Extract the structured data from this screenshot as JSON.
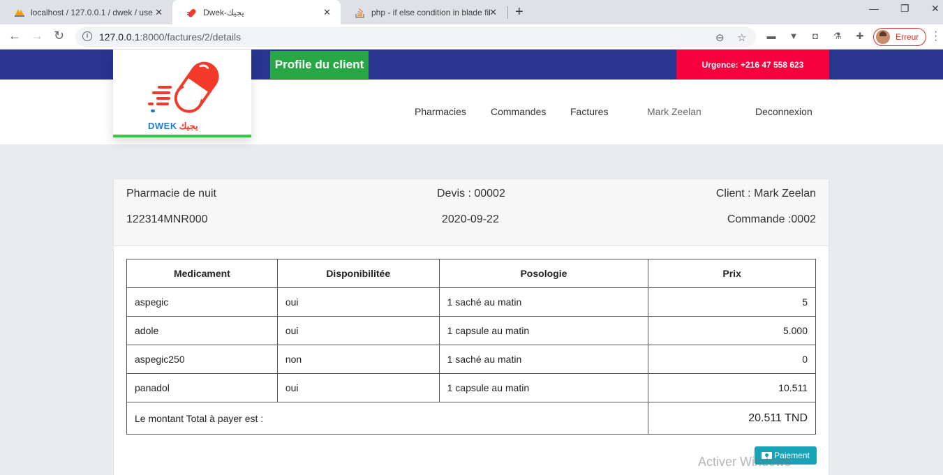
{
  "browser": {
    "tabs": [
      {
        "title": "localhost / 127.0.0.1 / dwek / use",
        "icon": "phpmyadmin-icon"
      },
      {
        "title": "Dwek-يجيك",
        "icon": "dwek-pill-icon"
      },
      {
        "title": "php - if else condition in blade fil",
        "icon": "stackoverflow-icon"
      }
    ],
    "url_host": "127.0.0.1",
    "url_path": ":8000/factures/2/details",
    "profile_label": "Erreur"
  },
  "header": {
    "profile_tag": "Profile du client",
    "urgence": "Urgence: +216 47 558 623",
    "logo_text": "DWEK",
    "logo_arabic": "يجيك",
    "nav": [
      "Pharmacies",
      "Commandes",
      "Factures",
      "Mark Zeelan",
      "Deconnexion"
    ]
  },
  "invoice": {
    "pharmacy": "Pharmacie de nuit",
    "pharmacy_code": "122314MNR000",
    "devis": "Devis : 00002",
    "date": "2020-09-22",
    "client": "Client : Mark Zeelan",
    "commande": "Commande :0002",
    "columns": [
      "Medicament",
      "Disponibilitée",
      "Posologie",
      "Prix"
    ],
    "rows": [
      {
        "med": "aspegic",
        "dispo": "oui",
        "poso": "1 saché au matin",
        "prix": "5"
      },
      {
        "med": "adole",
        "dispo": "oui",
        "poso": "1 capsule au matin",
        "prix": "5.000"
      },
      {
        "med": "aspegic250",
        "dispo": "non",
        "poso": "1 saché au matin",
        "prix": "0"
      },
      {
        "med": "panadol",
        "dispo": "oui",
        "poso": "1 capsule au matin",
        "prix": "10.511"
      }
    ],
    "total_label": "Le montant Total à payer est :",
    "total_value": "20.511 TND",
    "pay_button": "Paiement"
  },
  "watermark": "Activer Windows",
  "colors": {
    "topstrip": "#28358f",
    "profile_tag": "#28a745",
    "urgence": "#f5003d",
    "pay_button": "#17a2b8"
  }
}
